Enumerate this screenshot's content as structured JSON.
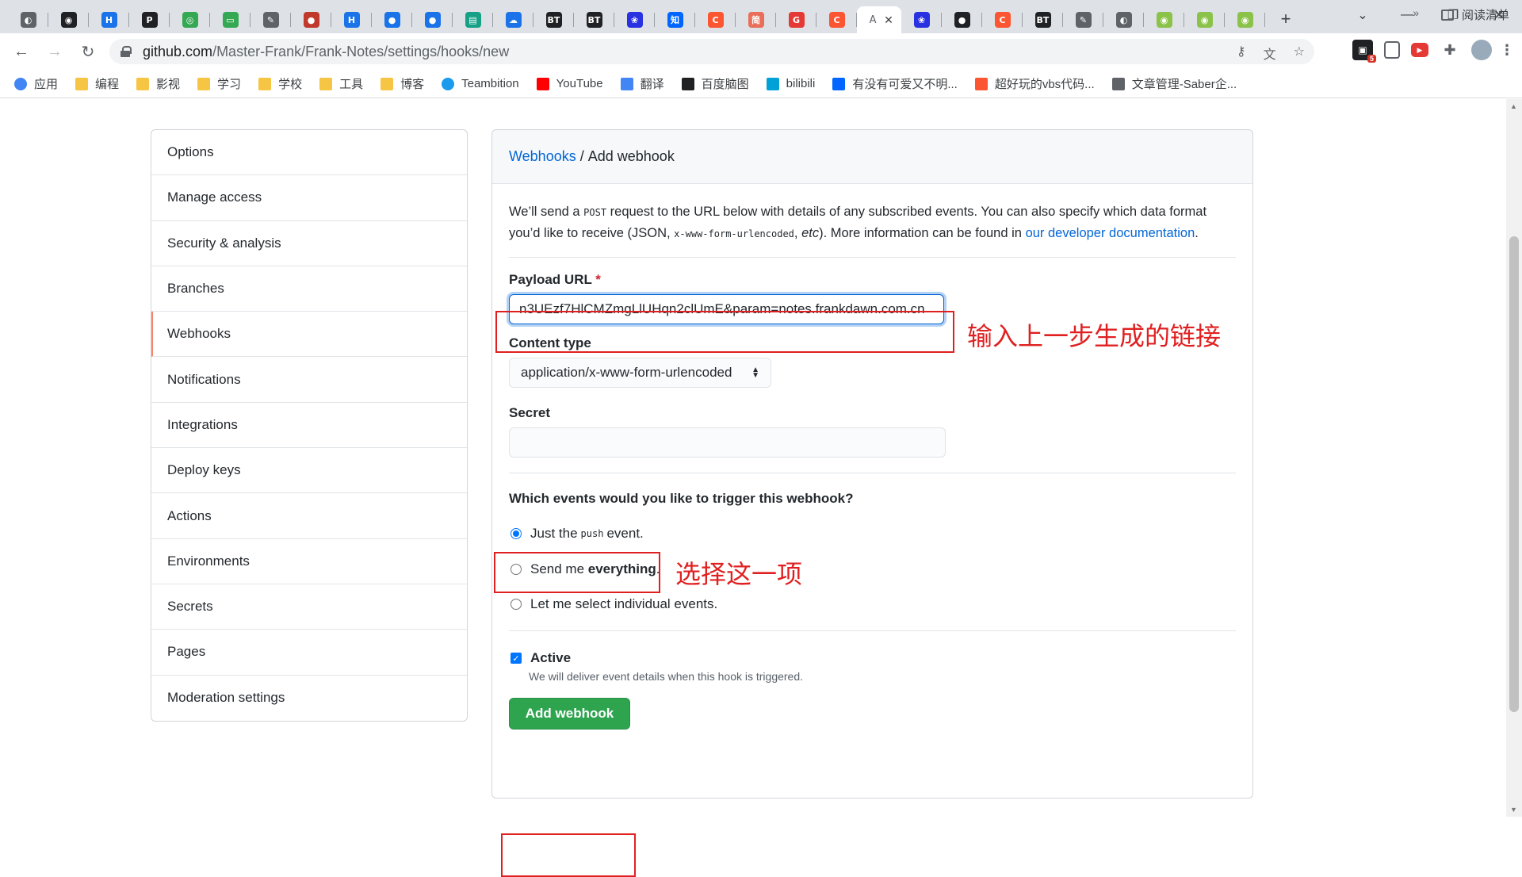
{
  "browser": {
    "tabs": [
      {
        "icon": "globe-icon",
        "color": "#5f6368",
        "glyph": "◐"
      },
      {
        "icon": "cat-icon",
        "color": "#202124",
        "glyph": "◉"
      },
      {
        "icon": "h-icon",
        "color": "#1a73e8",
        "glyph": "H"
      },
      {
        "icon": "p-icon",
        "color": "#202124",
        "glyph": "P"
      },
      {
        "icon": "chrome-icon",
        "color": "#34a853",
        "glyph": "◎"
      },
      {
        "icon": "comment-icon",
        "color": "#34a853",
        "glyph": "▭"
      },
      {
        "icon": "pen-icon",
        "color": "#5f6368",
        "glyph": "✎"
      },
      {
        "icon": "avatar-icon",
        "color": "#c0392b",
        "glyph": "●"
      },
      {
        "icon": "h-icon",
        "color": "#1a73e8",
        "glyph": "H"
      },
      {
        "icon": "devops-icon",
        "color": "#1a73e8",
        "glyph": "●"
      },
      {
        "icon": "devops-icon",
        "color": "#1a73e8",
        "glyph": "●"
      },
      {
        "icon": "note-icon",
        "color": "#16a085",
        "glyph": "▤"
      },
      {
        "icon": "cloud-icon",
        "color": "#1a73e8",
        "glyph": "☁"
      },
      {
        "icon": "bt-icon",
        "color": "#202124",
        "glyph": "BT"
      },
      {
        "icon": "bt-icon",
        "color": "#202124",
        "glyph": "BT"
      },
      {
        "icon": "baidu-icon",
        "color": "#2932e1",
        "glyph": "❀"
      },
      {
        "icon": "zhihu-icon",
        "color": "#0066ff",
        "glyph": "知"
      },
      {
        "icon": "csdn-icon",
        "color": "#fc5531",
        "glyph": "C"
      },
      {
        "icon": "jianshu-icon",
        "color": "#ea6f5a",
        "glyph": "简"
      },
      {
        "icon": "g-icon",
        "color": "#e53935",
        "glyph": "G"
      },
      {
        "icon": "csdn-icon",
        "color": "#fc5531",
        "glyph": "C"
      }
    ],
    "active_tab": {
      "icon": "pen-icon",
      "glyph": "A",
      "close": "✕"
    },
    "tabs_after": [
      {
        "icon": "baidu-icon",
        "color": "#2932e1",
        "glyph": "❀"
      },
      {
        "icon": "bear-icon",
        "color": "#202124",
        "glyph": "●"
      },
      {
        "icon": "csdn-icon",
        "color": "#fc5531",
        "glyph": "C"
      },
      {
        "icon": "bt-icon",
        "color": "#202124",
        "glyph": "BT"
      },
      {
        "icon": "pen-icon",
        "color": "#5f6368",
        "glyph": "✎"
      },
      {
        "icon": "globe-icon",
        "color": "#5f6368",
        "glyph": "◐"
      },
      {
        "icon": "android-icon",
        "color": "#8bc34a",
        "glyph": "◉"
      },
      {
        "icon": "android-icon",
        "color": "#8bc34a",
        "glyph": "◉"
      },
      {
        "icon": "android-icon",
        "color": "#8bc34a",
        "glyph": "◉"
      }
    ],
    "new_tab": "+",
    "url_host": "github.com",
    "url_path": "/Master-Frank/Frank-Notes/settings/hooks/new",
    "extension_badge": "5",
    "bookmarks": [
      {
        "label": "应用",
        "type": "apps"
      },
      {
        "label": "编程",
        "type": "folder"
      },
      {
        "label": "影视",
        "type": "folder"
      },
      {
        "label": "学习",
        "type": "folder"
      },
      {
        "label": "学校",
        "type": "folder"
      },
      {
        "label": "工具",
        "type": "folder"
      },
      {
        "label": "博客",
        "type": "folder"
      },
      {
        "label": "Teambition",
        "type": "teambition"
      },
      {
        "label": "YouTube",
        "type": "youtube"
      },
      {
        "label": "翻译",
        "type": "translate"
      },
      {
        "label": "百度脑图",
        "type": "mindmap"
      },
      {
        "label": "bilibili",
        "type": "bilibili"
      },
      {
        "label": "有没有可爱又不明...",
        "type": "zhihu"
      },
      {
        "label": "超好玩的vbs代码...",
        "type": "csdn"
      },
      {
        "label": "文章管理-Saber企...",
        "type": "pen"
      }
    ],
    "bookmarks_more": "»",
    "reading_list": "阅读清单"
  },
  "sidebar": {
    "items": [
      {
        "label": "Options"
      },
      {
        "label": "Manage access"
      },
      {
        "label": "Security & analysis"
      },
      {
        "label": "Branches"
      },
      {
        "label": "Webhooks",
        "selected": true
      },
      {
        "label": "Notifications"
      },
      {
        "label": "Integrations"
      },
      {
        "label": "Deploy keys"
      },
      {
        "label": "Actions"
      },
      {
        "label": "Environments"
      },
      {
        "label": "Secrets"
      },
      {
        "label": "Pages"
      },
      {
        "label": "Moderation settings"
      }
    ]
  },
  "form": {
    "breadcrumb_link": "Webhooks",
    "breadcrumb_sep": " / ",
    "breadcrumb_current": "Add webhook",
    "intro_1": "We’ll send a ",
    "intro_code1": "POST",
    "intro_2": " request to the URL below with details of any subscribed events. You can also specify which data format you’d like to receive (JSON, ",
    "intro_code2": "x-www-form-urlencoded",
    "intro_3": ", ",
    "intro_etc": "etc",
    "intro_4": "). More information can be found in ",
    "intro_link": "our developer documentation",
    "intro_5": ".",
    "payload_label": "Payload URL",
    "payload_required": "*",
    "payload_value": "n3UEzf7HlCMZmgLlUHqn2clUmE&param=notes.frankdawn.com.cn",
    "content_type_label": "Content type",
    "content_type_value": "application/x-www-form-urlencoded",
    "secret_label": "Secret",
    "secret_value": "",
    "events_question": "Which events would you like to trigger this webhook?",
    "event_push_1": "Just the",
    "event_push_code": "push",
    "event_push_2": "event.",
    "event_everything_1": "Send me ",
    "event_everything_2": "everything",
    "event_everything_3": ".",
    "event_individual": "Let me select individual events.",
    "active_label": "Active",
    "active_note": "We will deliver event details when this hook is triggered.",
    "submit": "Add webhook"
  },
  "annotations": {
    "url_hint": "输入上一步生成的链接",
    "choice_hint": "选择这一项",
    "color": "#e02020"
  }
}
